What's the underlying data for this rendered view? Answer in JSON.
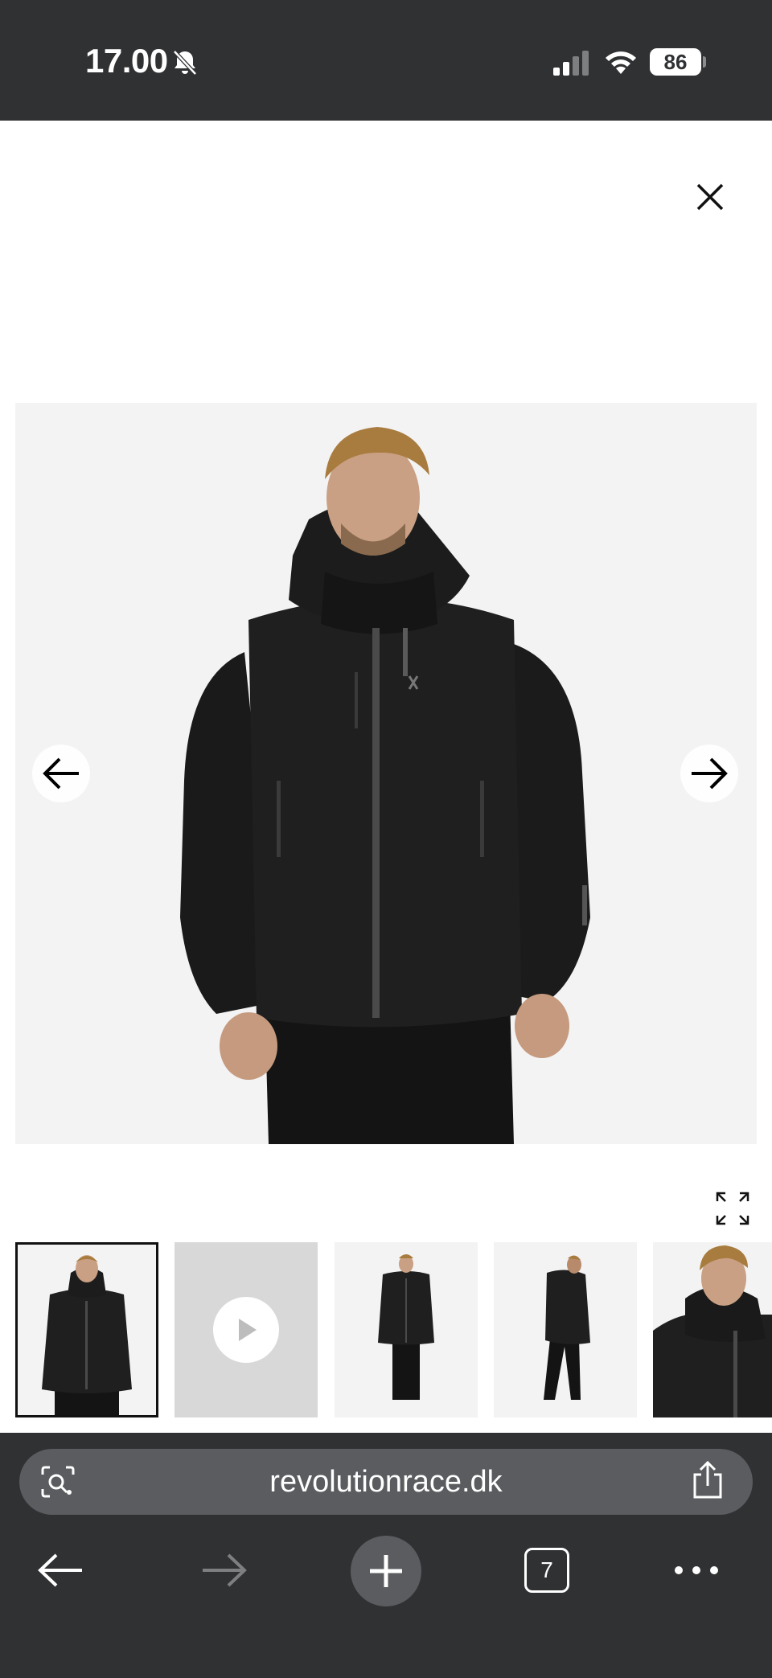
{
  "status_bar": {
    "time": "17.00",
    "battery": "86"
  },
  "product_viewer": {
    "thumbnails": [
      {
        "kind": "image",
        "active": true
      },
      {
        "kind": "video",
        "active": false
      },
      {
        "kind": "image",
        "active": false
      },
      {
        "kind": "image",
        "active": false
      },
      {
        "kind": "image",
        "active": false
      }
    ]
  },
  "browser": {
    "url": "revolutionrace.dk",
    "tab_count": "7"
  },
  "colors": {
    "chrome_bg": "#2f3133",
    "url_field_bg": "#5a5c5f",
    "image_bg": "#f3f3f3",
    "video_thumb_bg": "#d8d8d8"
  },
  "icons": {
    "status": [
      "bell-slash-icon",
      "cellular-signal-icon",
      "wifi-icon",
      "battery-icon"
    ],
    "viewer": [
      "close-icon",
      "arrow-left-icon",
      "arrow-right-icon",
      "fullscreen-icon",
      "play-icon"
    ],
    "browser": [
      "camera-search-icon",
      "share-icon",
      "back-arrow-icon",
      "forward-arrow-icon",
      "plus-icon",
      "tabs-icon",
      "more-icon"
    ]
  }
}
